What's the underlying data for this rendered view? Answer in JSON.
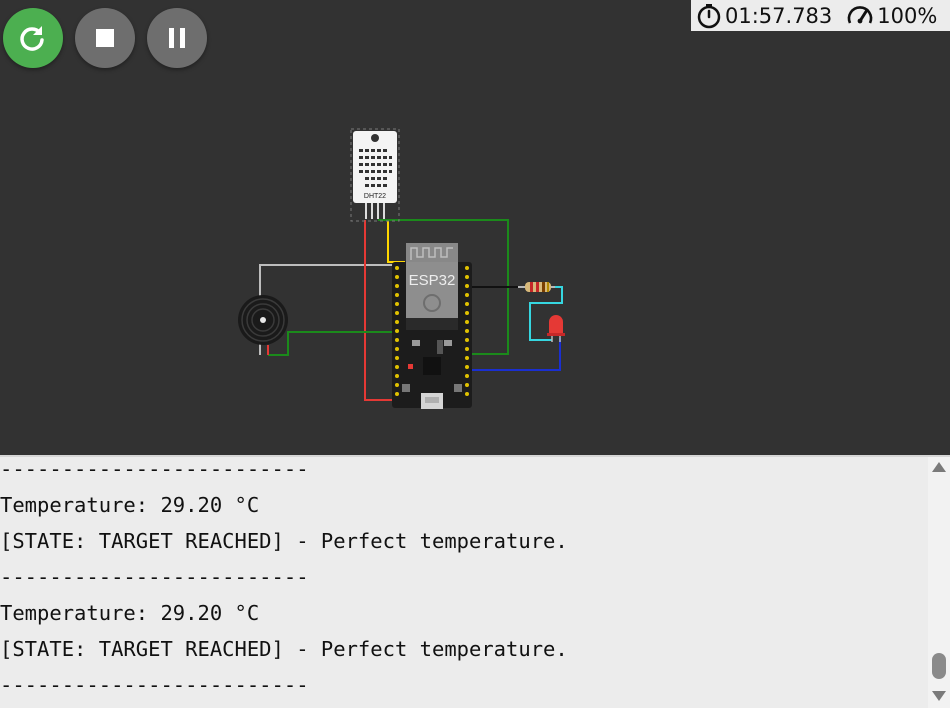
{
  "controls": {
    "restart": "restart-icon",
    "stop": "stop-icon",
    "pause": "pause-icon"
  },
  "status": {
    "timer_icon": "stopwatch-icon",
    "elapsed": "01:57.783",
    "speed_icon": "speedometer-icon",
    "speed": "100%"
  },
  "circuit": {
    "sensor_label": "DHT22",
    "board_label": "ESP32",
    "components": [
      "dht22-sensor",
      "esp32-board",
      "buzzer",
      "resistor",
      "red-led"
    ],
    "wire_colors": {
      "signal": "#ffd600",
      "power": "#e53935",
      "ground": "#1b8a1b",
      "buzzer": "#bdbdbd",
      "led": "#36d6e0",
      "return": "#1a2fd1",
      "data": "#111111"
    }
  },
  "serial": {
    "lines": [
      "-------------------------",
      "Temperature: 29.20 °C",
      "[STATE: TARGET REACHED] - Perfect temperature.",
      "-------------------------",
      "Temperature: 29.20 °C",
      "[STATE: TARGET REACHED] - Perfect temperature.",
      "-------------------------"
    ]
  },
  "colors": {
    "accent_green": "#4caf50",
    "control_gray": "#6e6e6e",
    "canvas_bg": "#323232",
    "console_bg": "#ececec"
  }
}
